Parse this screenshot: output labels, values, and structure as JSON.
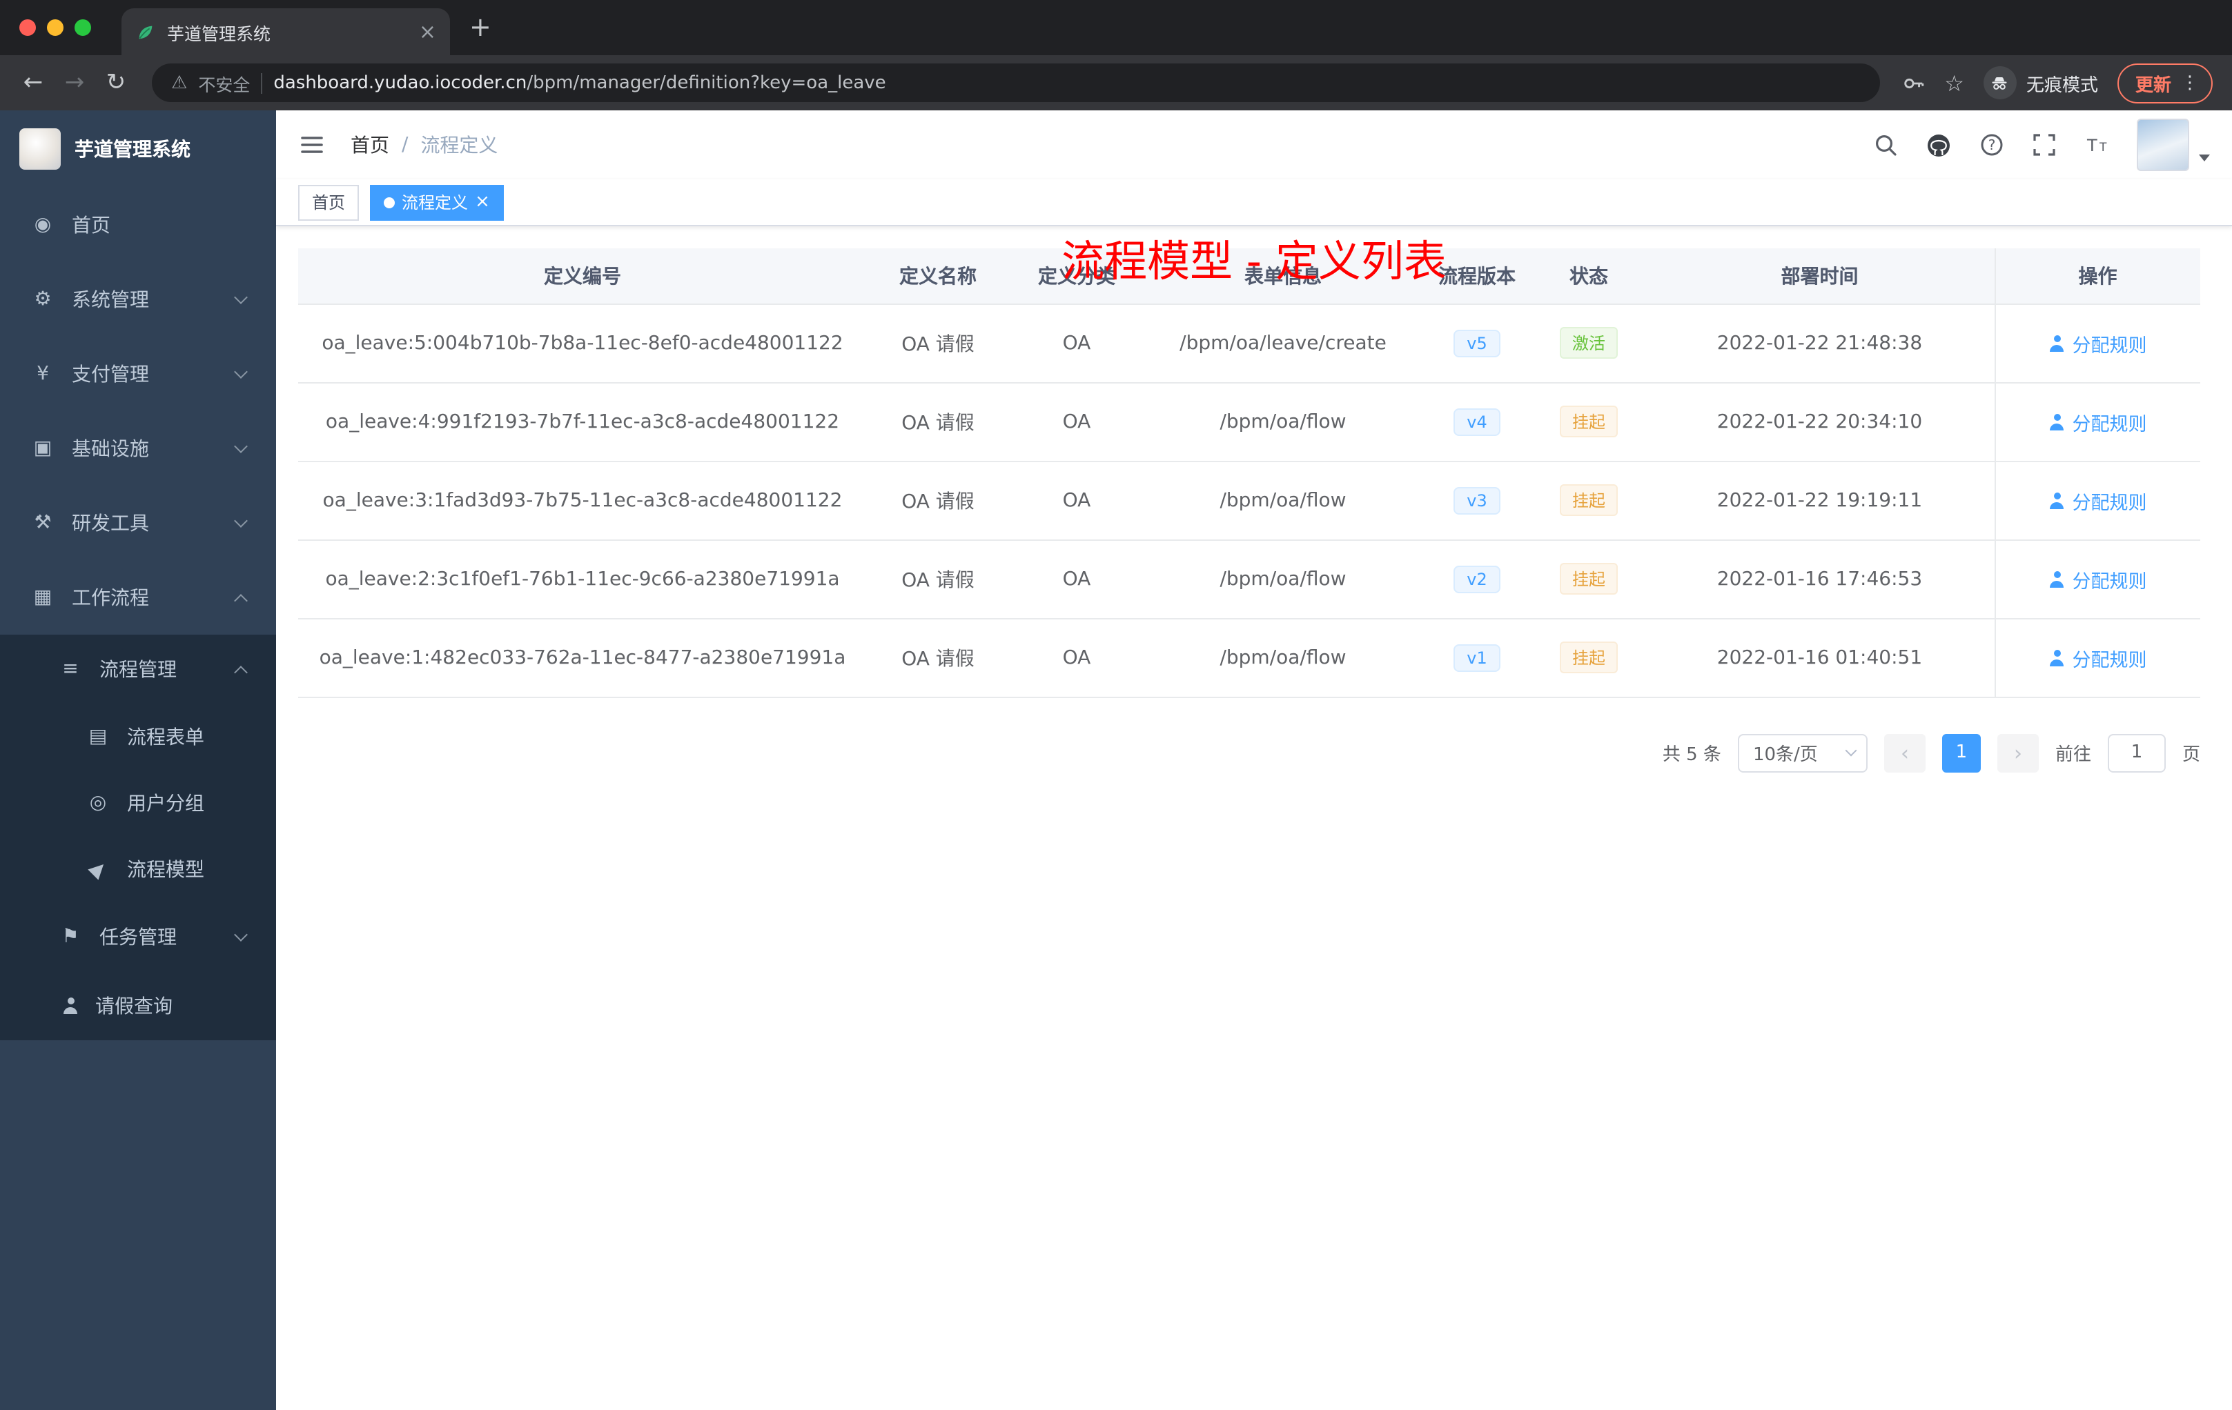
{
  "colors": {
    "accent": "#409eff",
    "success": "#67c23a",
    "warning": "#e6a23c",
    "annotation": "#ff0000",
    "sidebar": "#304156"
  },
  "browser": {
    "tab": {
      "title": "芋道管理系统",
      "close": "×"
    },
    "new_tab": "+",
    "nav": {
      "back": "←",
      "forward": "→",
      "reload": "↻"
    },
    "address": {
      "warning": "⚠",
      "security": "不安全",
      "domain": "dashboard.yudao.iocoder.cn",
      "path": "/bpm/manager/definition?key=oa_leave"
    },
    "star": "☆",
    "incognito": "无痕模式",
    "update": "更新",
    "menu_dots": "⋮"
  },
  "sidebar": {
    "title": "芋道管理系统",
    "items": [
      {
        "label": "首页"
      },
      {
        "label": "系统管理"
      },
      {
        "label": "支付管理"
      },
      {
        "label": "基础设施"
      },
      {
        "label": "研发工具"
      },
      {
        "label": "工作流程"
      },
      {
        "label": "流程管理"
      },
      {
        "label": "流程表单"
      },
      {
        "label": "用户分组"
      },
      {
        "label": "流程模型"
      },
      {
        "label": "任务管理"
      },
      {
        "label": "请假查询"
      }
    ]
  },
  "navbar": {
    "breadcrumb": {
      "home": "首页",
      "separator": "/",
      "current": "流程定义"
    },
    "annotation": "流程模型 - 定义列表"
  },
  "tags": {
    "home": "首页",
    "active": "流程定义",
    "close": "×"
  },
  "table": {
    "headers": [
      "定义编号",
      "定义名称",
      "定义分类",
      "表单信息",
      "流程版本",
      "状态",
      "部署时间",
      "操作"
    ],
    "rows": [
      {
        "id": "oa_leave:5:004b710b-7b8a-11ec-8ef0-acde48001122",
        "name": "OA 请假",
        "category": "OA",
        "form": "/bpm/oa/leave/create",
        "version": "v5",
        "status": "激活",
        "status_type": "success",
        "time": "2022-01-22 21:48:38",
        "action": "分配规则"
      },
      {
        "id": "oa_leave:4:991f2193-7b7f-11ec-a3c8-acde48001122",
        "name": "OA 请假",
        "category": "OA",
        "form": "/bpm/oa/flow",
        "version": "v4",
        "status": "挂起",
        "status_type": "warning",
        "time": "2022-01-22 20:34:10",
        "action": "分配规则"
      },
      {
        "id": "oa_leave:3:1fad3d93-7b75-11ec-a3c8-acde48001122",
        "name": "OA 请假",
        "category": "OA",
        "form": "/bpm/oa/flow",
        "version": "v3",
        "status": "挂起",
        "status_type": "warning",
        "time": "2022-01-22 19:19:11",
        "action": "分配规则"
      },
      {
        "id": "oa_leave:2:3c1f0ef1-76b1-11ec-9c66-a2380e71991a",
        "name": "OA 请假",
        "category": "OA",
        "form": "/bpm/oa/flow",
        "version": "v2",
        "status": "挂起",
        "status_type": "warning",
        "time": "2022-01-16 17:46:53",
        "action": "分配规则"
      },
      {
        "id": "oa_leave:1:482ec033-762a-11ec-8477-a2380e71991a",
        "name": "OA 请假",
        "category": "OA",
        "form": "/bpm/oa/flow",
        "version": "v1",
        "status": "挂起",
        "status_type": "warning",
        "time": "2022-01-16 01:40:51",
        "action": "分配规则"
      }
    ]
  },
  "pagination": {
    "total": "共 5 条",
    "page_size": "10条/页",
    "prev": "‹",
    "next": "›",
    "page": "1",
    "goto_label": "前往",
    "goto_value": "1",
    "unit": "页"
  }
}
